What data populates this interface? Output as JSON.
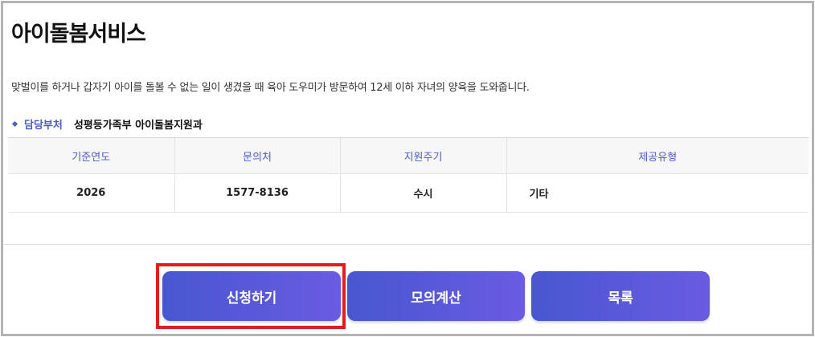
{
  "page": {
    "title": "아이돌봄서비스",
    "description": "맞벌이를 하거나 갑자기 아이를 돌볼 수 없는 일이 생겼을 때 육아 도우미가 방문하여 12세 이하 자녀의 양육을 도와줍니다."
  },
  "department": {
    "label": "담당부처",
    "value": "성평등가족부 아이돌봄지원과"
  },
  "table": {
    "headers": [
      "기준연도",
      "문의처",
      "지원주기",
      "제공유형"
    ],
    "row": [
      "2026",
      "1577-8136",
      "수시",
      "기타"
    ]
  },
  "buttons": {
    "apply": "신청하기",
    "calc": "모의계산",
    "list": "목록"
  },
  "colors": {
    "accent": "#4a5cc8",
    "button_start": "#4857cf",
    "button_end": "#6a5be2",
    "highlight": "#e01e1e"
  }
}
